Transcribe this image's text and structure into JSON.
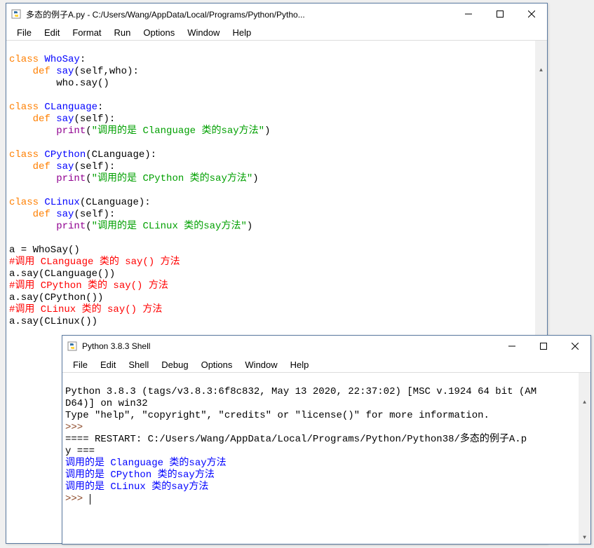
{
  "editorWindow": {
    "title": "多态的例子A.py - C:/Users/Wang/AppData/Local/Programs/Python/Pytho...",
    "menu": [
      "File",
      "Edit",
      "Format",
      "Run",
      "Options",
      "Window",
      "Help"
    ],
    "code": {
      "l1_kw": "class",
      "l1_cls": "WhoSay",
      "l1_rest": ":",
      "l2_kw": "def",
      "l2_fn": "say",
      "l2_rest": "(self,who):",
      "l3": "who.say()",
      "l4_kw": "class",
      "l4_cls": "CLanguage",
      "l4_rest": ":",
      "l5_kw": "def",
      "l5_fn": "say",
      "l5_rest": "(self):",
      "l6_fn": "print",
      "l6_open": "(",
      "l6_str": "\"调用的是 Clanguage 类的say方法\"",
      "l6_close": ")",
      "l7_kw": "class",
      "l7_cls": "CPython",
      "l7_rest": "(CLanguage):",
      "l8_kw": "def",
      "l8_fn": "say",
      "l8_rest": "(self):",
      "l9_fn": "print",
      "l9_open": "(",
      "l9_str": "\"调用的是 CPython 类的say方法\"",
      "l9_close": ")",
      "l10_kw": "class",
      "l10_cls": "CLinux",
      "l10_rest": "(CLanguage):",
      "l11_kw": "def",
      "l11_fn": "say",
      "l11_rest": "(self):",
      "l12_fn": "print",
      "l12_open": "(",
      "l12_str": "\"调用的是 CLinux 类的say方法\"",
      "l12_close": ")",
      "l13": "a = WhoSay()",
      "l14": "#调用 CLanguage 类的 say() 方法",
      "l15": "a.say(CLanguage())",
      "l16": "#调用 CPython 类的 say() 方法",
      "l17": "a.say(CPython())",
      "l18": "#调用 CLinux 类的 say() 方法",
      "l19": "a.say(CLinux())"
    }
  },
  "shellWindow": {
    "title": "Python 3.8.3 Shell",
    "menu": [
      "File",
      "Edit",
      "Shell",
      "Debug",
      "Options",
      "Window",
      "Help"
    ],
    "out": {
      "banner1": "Python 3.8.3 (tags/v3.8.3:6f8c832, May 13 2020, 22:37:02) [MSC v.1924 64 bit (AM",
      "banner2": "D64)] on win32",
      "banner3": "Type \"help\", \"copyright\", \"credits\" or \"license()\" for more information.",
      "prompt": ">>> ",
      "restart1": "==== RESTART: C:/Users/Wang/AppData/Local/Programs/Python/Python38/多态的例子A.p",
      "restart2": "y ===",
      "o1": "调用的是 Clanguage 类的say方法",
      "o2": "调用的是 CPython 类的say方法",
      "o3": "调用的是 CLinux 类的say方法"
    }
  }
}
